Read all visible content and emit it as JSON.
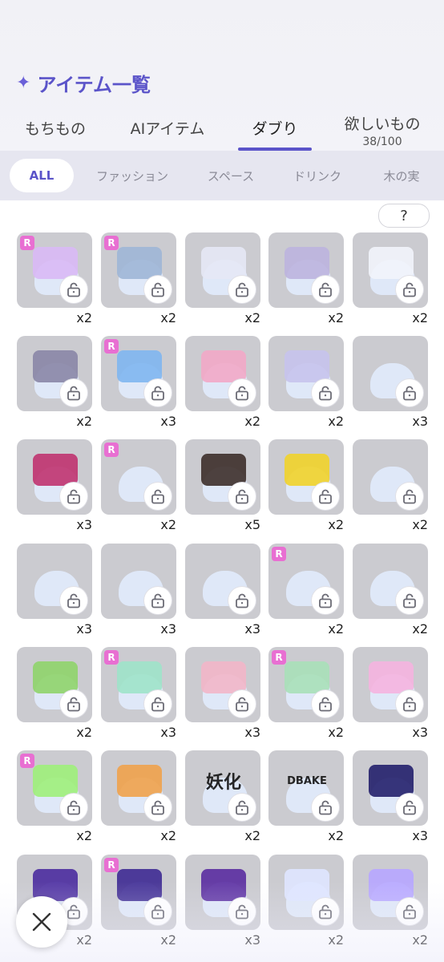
{
  "header": {
    "title": "アイテム一覧",
    "title_icon": "sparkle-icon"
  },
  "tabs": [
    {
      "label": "もちもの",
      "active": false
    },
    {
      "label": "AIアイテム",
      "active": false
    },
    {
      "label": "ダブり",
      "active": true
    },
    {
      "label": "欲しいもの",
      "sub": "38/100",
      "active": false
    }
  ],
  "filters": [
    {
      "label": "ALL",
      "active": true
    },
    {
      "label": "ファッション",
      "active": false
    },
    {
      "label": "スペース",
      "active": false
    },
    {
      "label": "ドリンク",
      "active": false
    },
    {
      "label": "木の実",
      "active": false
    }
  ],
  "help_label": "?",
  "colors": {
    "accent": "#5b54c9",
    "r_badge": "#e86fd2",
    "tile": "#cbcbd0"
  },
  "items": [
    {
      "r": true,
      "count": "x2",
      "deco": "#d9b9f5"
    },
    {
      "r": true,
      "count": "x2",
      "deco": "#9fb6d6"
    },
    {
      "r": false,
      "count": "x2",
      "deco": "#e5e8f5"
    },
    {
      "r": false,
      "count": "x2",
      "deco": "#bcb4de"
    },
    {
      "r": false,
      "count": "x2",
      "deco": "#f2f4fb"
    },
    {
      "r": false,
      "count": "x2",
      "deco": "#8a86a6"
    },
    {
      "r": true,
      "count": "x3",
      "deco": "#7fb6f0"
    },
    {
      "r": false,
      "count": "x2",
      "deco": "#f2a9c6"
    },
    {
      "r": false,
      "count": "x2",
      "deco": "#c7c3ec"
    },
    {
      "r": false,
      "count": "x3",
      "deco": ""
    },
    {
      "r": false,
      "count": "x3",
      "deco": "#c0336f"
    },
    {
      "r": true,
      "count": "x2",
      "deco": ""
    },
    {
      "r": false,
      "count": "x5",
      "deco": "#3d2f2a"
    },
    {
      "r": false,
      "count": "x2",
      "deco": "#f1d32a"
    },
    {
      "r": false,
      "count": "x2",
      "deco": ""
    },
    {
      "r": false,
      "count": "x3",
      "deco": ""
    },
    {
      "r": false,
      "count": "x3",
      "deco": ""
    },
    {
      "r": false,
      "count": "x3",
      "deco": ""
    },
    {
      "r": true,
      "count": "x2",
      "deco": ""
    },
    {
      "r": false,
      "count": "x2",
      "deco": ""
    },
    {
      "r": false,
      "count": "x2",
      "deco": "#8fd46a"
    },
    {
      "r": true,
      "count": "x3",
      "deco": "#9fe3c9"
    },
    {
      "r": false,
      "count": "x3",
      "deco": "#f2b6c8"
    },
    {
      "r": true,
      "count": "x2",
      "deco": "#a9e0b8"
    },
    {
      "r": false,
      "count": "x3",
      "deco": "#f5b4df"
    },
    {
      "r": true,
      "count": "x2",
      "deco": "#9ef07a"
    },
    {
      "r": false,
      "count": "x2",
      "deco": "#f0a24b"
    },
    {
      "r": false,
      "count": "x2",
      "deco": "#111111",
      "label": "妖化"
    },
    {
      "r": false,
      "count": "x2",
      "deco": "#111111",
      "label": "DBAKE"
    },
    {
      "r": false,
      "count": "x3",
      "deco": "#23206b"
    },
    {
      "r": false,
      "count": "x2",
      "deco": "#4b2c9e"
    },
    {
      "r": true,
      "count": "x2",
      "deco": "#3e2a92"
    },
    {
      "r": false,
      "count": "x3",
      "deco": "#5a2ca0"
    },
    {
      "r": false,
      "count": "x2",
      "deco": "#dfe6ff"
    },
    {
      "r": false,
      "count": "x2",
      "deco": "#b7a6ff"
    }
  ]
}
